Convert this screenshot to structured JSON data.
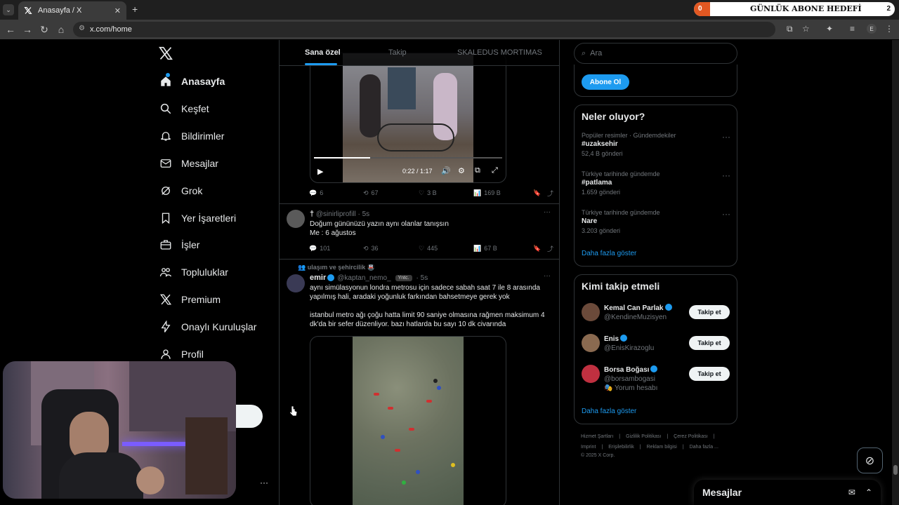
{
  "browser": {
    "tab_title": "Anasayfa / X",
    "url": "x.com/home",
    "new_tab": "+"
  },
  "overlay": {
    "label": "GÜNLÜK ABONE HEDEFİ",
    "current": "0",
    "goal": "2",
    "progress": 0.08,
    "color": "#e25822"
  },
  "nav": {
    "items": [
      {
        "label": "Anasayfa",
        "icon": "home-icon"
      },
      {
        "label": "Keşfet",
        "icon": "search-icon"
      },
      {
        "label": "Bildirimler",
        "icon": "bell-icon"
      },
      {
        "label": "Mesajlar",
        "icon": "mail-icon"
      },
      {
        "label": "Grok",
        "icon": "grok-icon"
      },
      {
        "label": "Yer İşaretleri",
        "icon": "bookmark-icon"
      },
      {
        "label": "İşler",
        "icon": "briefcase-icon"
      },
      {
        "label": "Topluluklar",
        "icon": "communities-icon"
      },
      {
        "label": "Premium",
        "icon": "x-logo-icon"
      },
      {
        "label": "Onaylı Kuruluşlar",
        "icon": "lightning-icon"
      },
      {
        "label": "Profil",
        "icon": "profile-icon"
      }
    ],
    "more": "···"
  },
  "feed": {
    "tabs": [
      "Sana özel",
      "Takip",
      "SKALEDUS MORTIMAS"
    ],
    "video": {
      "time": "0:22 / 1:17"
    },
    "tweet1_stats": {
      "replies": "6",
      "reposts": "67",
      "likes": "3 B",
      "views": "169 B"
    },
    "tweet2": {
      "handle": "@sinirliprofill",
      "time": "· 5s",
      "name": "†",
      "line1": "Doğum gününüzü yazın aynı olanlar tanışsın",
      "line2": "Me : 6 ağustos",
      "stats": {
        "replies": "101",
        "reposts": "36",
        "likes": "445",
        "views": "67 B"
      }
    },
    "tweet3": {
      "context": "ulaşım ve şehircilik 🚇",
      "name": "emir",
      "handle": "@kaptan_nemo_",
      "badge": "Yntc.",
      "time": "· 5s",
      "p1": "aynı simülasyonun londra metrosu için sadece sabah saat 7 ile 8 arasında yapılmış hali, aradaki yoğunluk farkından bahsetmeye gerek yok",
      "p2": "istanbul metro ağı çoğu hatta limit 90 saniye olmasına rağmen maksimum 4 dk'da bir sefer düzenliyor. bazı hatlarda bu sayı 10 dk civarında"
    }
  },
  "right": {
    "search_placeholder": "Ara",
    "subscribe_button": "Abone Ol",
    "trends_title": "Neler oluyor?",
    "trends": [
      {
        "header": "Popüler resimler · Gündemdekiler",
        "title": "#uzaksehir",
        "count": "52,4 B gönderi"
      },
      {
        "header": "Türkiye tarihinde gündemde",
        "title": "#patlama",
        "count": "1.659 gönderi"
      },
      {
        "header": "Türkiye tarihinde gündemde",
        "title": "Nare",
        "count": "3.203 gönderi"
      }
    ],
    "show_more": "Daha fazla göster",
    "follow_title": "Kimi takip etmeli",
    "follow": [
      {
        "name": "Kemal Can Parlak",
        "handle": "@KendineMuzisyen",
        "button": "Takip et",
        "note": ""
      },
      {
        "name": "Enis",
        "handle": "@EnisKirazoglu",
        "button": "Takip et",
        "note": ""
      },
      {
        "name": "Borsa Boğası",
        "handle": "@borsambogasi",
        "button": "Takip et",
        "note": "🎭 Yorum hesabı"
      }
    ],
    "footer_line1": [
      "Hizmet Şartları",
      "|",
      "Gizlilik Politikası",
      "|",
      "Çerez Politikası",
      "|"
    ],
    "footer_line2": [
      "Imprint",
      "|",
      "Erişilebilirlik",
      "|",
      "Reklam bilgisi",
      "|",
      "Daha fazla ..."
    ],
    "copyright": "© 2025 X Corp."
  },
  "messages": {
    "title": "Mesajlar"
  },
  "colors": {
    "accent": "#1d9bf0",
    "border": "#2f3336",
    "muted": "#71767b"
  }
}
